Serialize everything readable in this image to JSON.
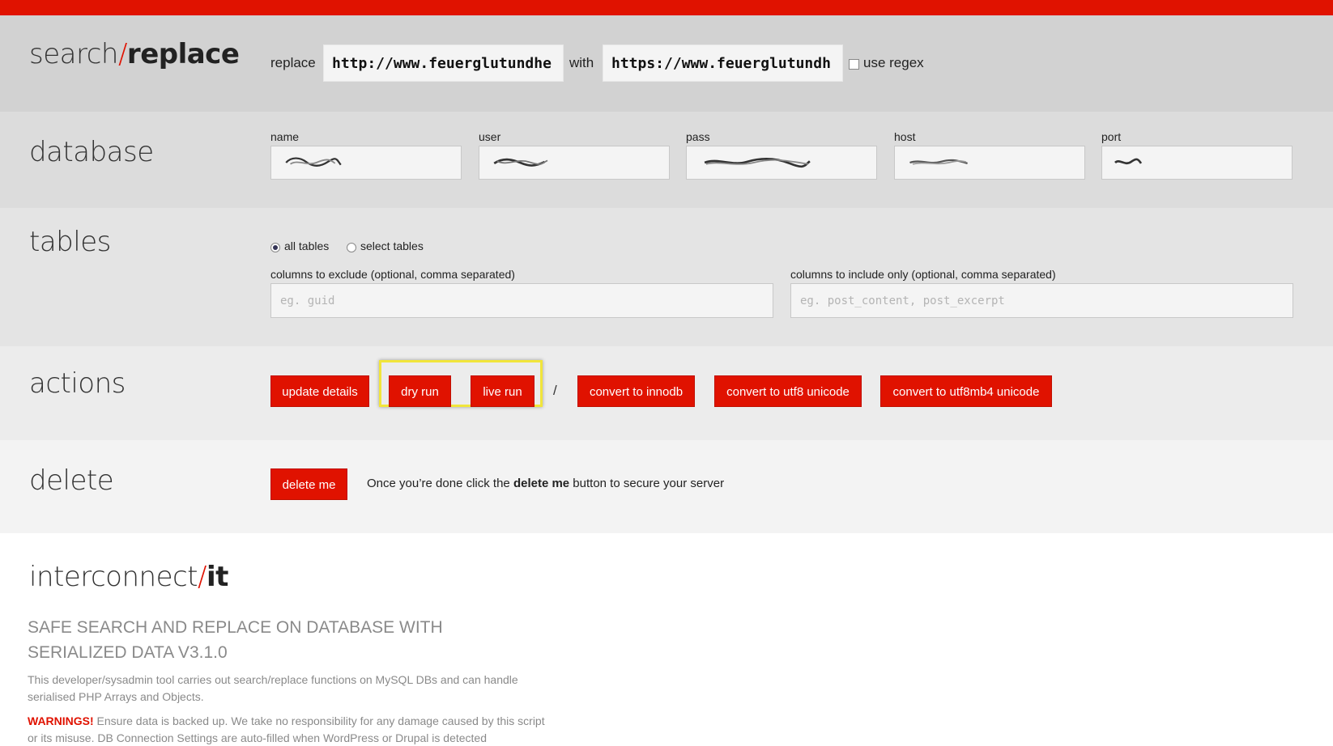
{
  "brand": {
    "search_word": "search",
    "slash": "/",
    "replace_word": "replace",
    "footer_word": "interconnect",
    "footer_suffix": "it",
    "accent_color": "#e01200"
  },
  "search_replace": {
    "replace_label": "replace",
    "replace_value": "http://www.feuerglutundhe",
    "with_label": "with",
    "with_value": "https://www.feuerglutundh",
    "regex_label": "use regex",
    "regex_checked": false
  },
  "database": {
    "heading": "database",
    "fields": {
      "name": "name",
      "user": "user",
      "pass": "pass",
      "host": "host",
      "port": "port"
    }
  },
  "tables": {
    "heading": "tables",
    "all_tables_label": "all tables",
    "select_tables_label": "select tables",
    "selected": "all tables",
    "exclude_label": "columns to exclude (optional, comma separated)",
    "exclude_placeholder": "eg. guid",
    "include_label": "columns to include only (optional, comma separated)",
    "include_placeholder": "eg. post_content, post_excerpt"
  },
  "actions": {
    "heading": "actions",
    "update_details": "update details",
    "dry_run": "dry run",
    "live_run": "live run",
    "separator": "/",
    "convert_innodb": "convert to innodb",
    "convert_utf8": "convert to utf8 unicode",
    "convert_utf8mb4": "convert to utf8mb4 unicode"
  },
  "delete": {
    "heading": "delete",
    "button": "delete me",
    "text_before": "Once you’re done click the ",
    "text_bold": "delete me",
    "text_after": " button to secure your server"
  },
  "footer": {
    "title": "Safe Search and Replace on Database with Serialized Data v3.1.0",
    "description": "This developer/sysadmin tool carries out search/replace functions on MySQL DBs and can handle serialised PHP Arrays and Objects.",
    "warning_label": "WARNINGS!",
    "warning_text": " Ensure data is backed up. We take no responsibility for any damage caused by this script or its misuse. DB Connection Settings are auto-filled when WordPress or Drupal is detected"
  },
  "icons": {
    "checkbox": "checkbox-icon",
    "radio": "radio-icon",
    "scribble": "redacted-scribble-icon"
  }
}
